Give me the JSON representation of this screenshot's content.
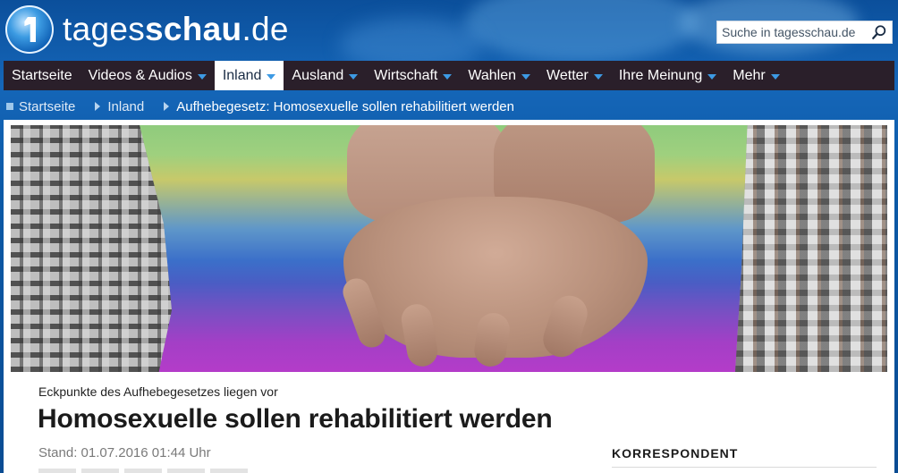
{
  "header": {
    "logo_text_regular": "tages",
    "logo_text_bold": "schau",
    "logo_text_suffix": ".de",
    "search_placeholder": "Suche in tagesschau.de"
  },
  "nav": {
    "items": [
      {
        "label": "Startseite",
        "has_dropdown": false,
        "active": false
      },
      {
        "label": "Videos & Audios",
        "has_dropdown": true,
        "active": false
      },
      {
        "label": "Inland",
        "has_dropdown": true,
        "active": true
      },
      {
        "label": "Ausland",
        "has_dropdown": true,
        "active": false
      },
      {
        "label": "Wirtschaft",
        "has_dropdown": true,
        "active": false
      },
      {
        "label": "Wahlen",
        "has_dropdown": true,
        "active": false
      },
      {
        "label": "Wetter",
        "has_dropdown": true,
        "active": false
      },
      {
        "label": "Ihre Meinung",
        "has_dropdown": true,
        "active": false
      },
      {
        "label": "Mehr",
        "has_dropdown": true,
        "active": false
      }
    ]
  },
  "breadcrumb": {
    "items": [
      "Startseite",
      "Inland",
      "Aufhebegesetz: Homosexuelle sollen rehabilitiert werden"
    ]
  },
  "article": {
    "kicker": "Eckpunkte des Aufhebegesetzes liegen vor",
    "headline": "Homosexuelle sollen rehabilitiert werden",
    "stand": "Stand: 01.07.2016 01:44 Uhr"
  },
  "sidebar": {
    "title": "KORRESPONDENT"
  },
  "colors": {
    "nav_background": "#2a1f2a",
    "caret_accent": "#3d9ae4",
    "header_blue": "#0b4f9b"
  },
  "icons": {
    "search": "search-icon",
    "logo": "tagesschau-logo-icon",
    "dropdown": "chevron-down-icon"
  }
}
